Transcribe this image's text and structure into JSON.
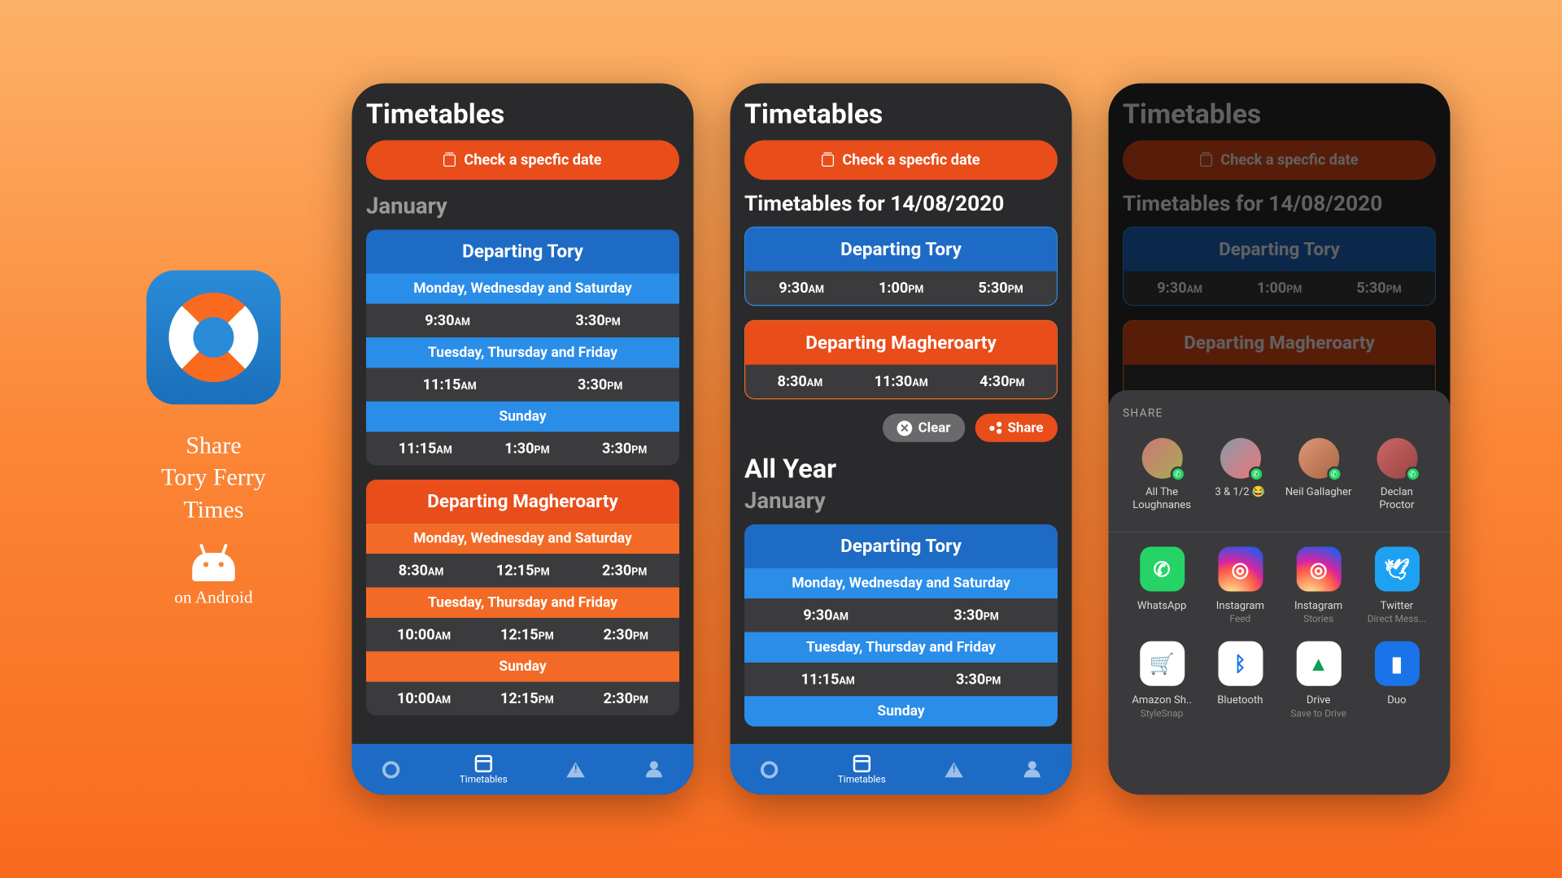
{
  "intro": {
    "title": "Share\nTory Ferry\nTimes",
    "platform": "on Android"
  },
  "common": {
    "page_title": "Timetables",
    "check_button": "Check a specfic date",
    "tabs": {
      "home": "",
      "timetables": "Timetables",
      "alerts": "",
      "account": ""
    }
  },
  "phone1": {
    "month": "January",
    "cards": [
      {
        "color": "blue",
        "header": "Departing Tory",
        "rows": [
          {
            "sub": "Monday, Wednesday and Saturday",
            "times": [
              "9:30AM",
              "3:30PM"
            ]
          },
          {
            "sub": "Tuesday, Thursday and Friday",
            "times": [
              "11:15AM",
              "3:30PM"
            ]
          },
          {
            "sub": "Sunday",
            "times": [
              "11:15AM",
              "1:30PM",
              "3:30PM"
            ]
          }
        ]
      },
      {
        "color": "orange",
        "header": "Departing Magheroarty",
        "rows": [
          {
            "sub": "Monday, Wednesday and Saturday",
            "times": [
              "8:30AM",
              "12:15PM",
              "2:30PM"
            ]
          },
          {
            "sub": "Tuesday, Thursday and Friday",
            "times": [
              "10:00AM",
              "12:15PM",
              "2:30PM"
            ]
          },
          {
            "sub": "Sunday",
            "times": [
              "10:00AM",
              "12:15PM",
              "2:30PM"
            ]
          }
        ]
      }
    ]
  },
  "phone2": {
    "date_label": "Timetables for 14/08/2020",
    "date_cards": [
      {
        "color": "blue",
        "header": "Departing Tory",
        "times": [
          "9:30AM",
          "1:00PM",
          "5:30PM"
        ]
      },
      {
        "color": "orange",
        "header": "Departing Magheroarty",
        "times": [
          "8:30AM",
          "11:30AM",
          "4:30PM"
        ]
      }
    ],
    "actions": {
      "clear": "Clear",
      "share": "Share"
    },
    "all_year": "All Year",
    "month": "January",
    "first_card_header": "Departing Tory",
    "first_card_rows": [
      {
        "sub": "Monday, Wednesday and Saturday",
        "times": [
          "9:30AM",
          "3:30PM"
        ]
      },
      {
        "sub": "Tuesday, Thursday and Friday",
        "times": [
          "11:15AM",
          "3:30PM"
        ]
      },
      {
        "sub": "Sunday"
      }
    ]
  },
  "phone3": {
    "date_label": "Timetables for 14/08/2020",
    "date_cards": [
      {
        "color": "blue",
        "header": "Departing Tory",
        "times": [
          "9:30AM",
          "1:00PM",
          "5:30PM"
        ]
      },
      {
        "color": "orange",
        "header": "Departing Magheroarty"
      }
    ],
    "share_sheet": {
      "title": "SHARE",
      "contacts": [
        {
          "name": "All The Loughnanes"
        },
        {
          "name": "3 & 1/2 😂"
        },
        {
          "name": "Neil Gallagher"
        },
        {
          "name": "Declan Proctor"
        }
      ],
      "apps_row1": [
        {
          "name": "WhatsApp",
          "sub": "",
          "cls": "ic-wa",
          "glyph": "✆"
        },
        {
          "name": "Instagram",
          "sub": "Feed",
          "cls": "ic-ig",
          "glyph": "⌾"
        },
        {
          "name": "Instagram",
          "sub": "Stories",
          "cls": "ic-ig",
          "glyph": "⌾"
        },
        {
          "name": "Twitter",
          "sub": "Direct Mess...",
          "cls": "ic-tw",
          "glyph": "🕊"
        }
      ],
      "apps_row2": [
        {
          "name": "Amazon Sh..",
          "sub": "StyleSnap",
          "cls": "ic-wh",
          "glyph": "🛒"
        },
        {
          "name": "Bluetooth",
          "sub": "",
          "cls": "ic-wh",
          "glyph": "ᛒ"
        },
        {
          "name": "Drive",
          "sub": "Save to Drive",
          "cls": "ic-drv",
          "glyph": "▲"
        },
        {
          "name": "Duo",
          "sub": "",
          "cls": "ic-duo",
          "glyph": "▮"
        }
      ]
    }
  }
}
